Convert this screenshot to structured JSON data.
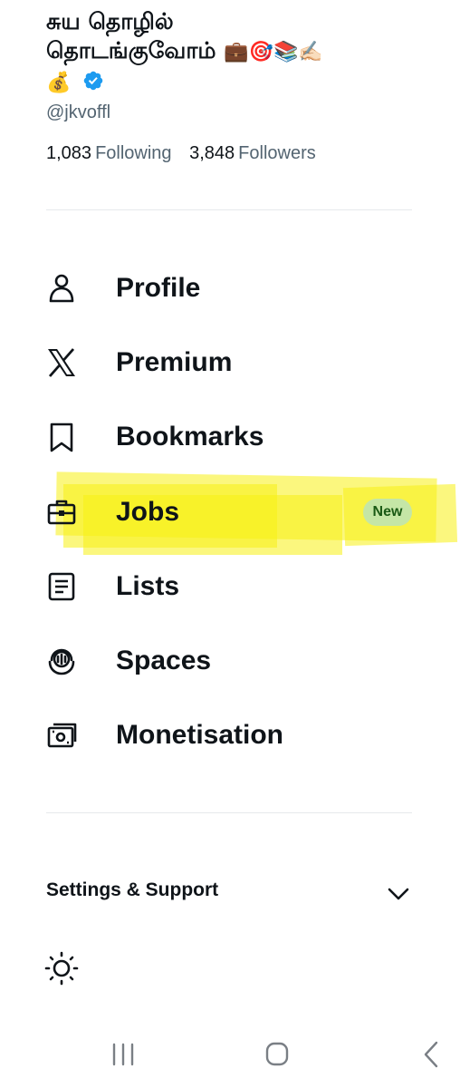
{
  "profile": {
    "name_line1": "சுய தொழில்",
    "name_line2": "தொடங்குவோம்",
    "name_emojis": "💼🎯📚✍🏻",
    "name_emoji_money": "💰",
    "handle": "@jkvoffl",
    "following_count": "1,083",
    "following_label": "Following",
    "followers_count": "3,848",
    "followers_label": "Followers",
    "verified_color": "#1d9bf0"
  },
  "menu": {
    "items": [
      {
        "label": "Profile",
        "icon": "person-icon"
      },
      {
        "label": "Premium",
        "icon": "x-logo-icon"
      },
      {
        "label": "Bookmarks",
        "icon": "bookmark-icon"
      },
      {
        "label": "Jobs",
        "icon": "briefcase-icon",
        "badge": "New",
        "highlighted": true
      },
      {
        "label": "Lists",
        "icon": "list-icon"
      },
      {
        "label": "Spaces",
        "icon": "spaces-icon"
      },
      {
        "label": "Monetisation",
        "icon": "money-icon"
      }
    ]
  },
  "settings": {
    "label": "Settings & Support",
    "icon": "chevron-down-icon"
  },
  "theme": {
    "icon": "sun-icon"
  },
  "system_nav": {
    "recents_icon": "recents-icon",
    "home_icon": "home-icon",
    "back_icon": "back-icon"
  },
  "colors": {
    "highlight": "#f8f014",
    "badge_bg": "#c5e6a6",
    "badge_text": "#1a5a14",
    "secondary_text": "#536471"
  }
}
